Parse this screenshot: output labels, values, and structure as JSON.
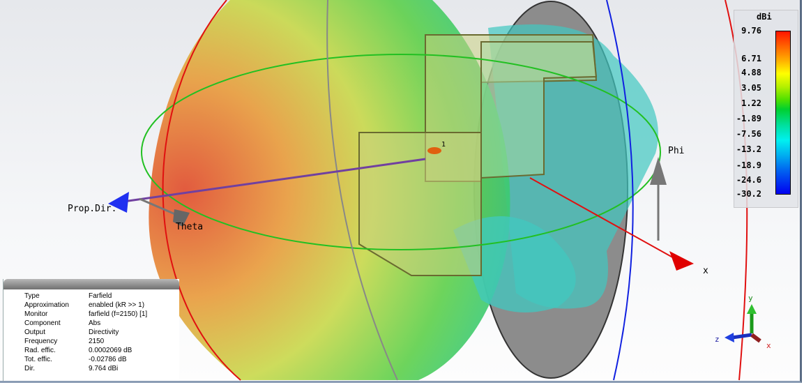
{
  "labels": {
    "prop_dir": "Prop.Dir.",
    "theta": "Theta",
    "phi": "Phi",
    "x": "x",
    "port": "1"
  },
  "legend": {
    "unit": "dBi",
    "ticks": [
      "9.76",
      "6.71",
      "4.88",
      "3.05",
      "1.22",
      "-1.89",
      "-7.56",
      "-13.2",
      "-18.9",
      "-24.6",
      "-30.2"
    ]
  },
  "axes": {
    "x": "x",
    "y": "y",
    "z": "z"
  },
  "info": [
    {
      "k": "Type",
      "v": "Farfield"
    },
    {
      "k": "Approximation",
      "v": "enabled (kR >> 1)"
    },
    {
      "k": "Monitor",
      "v": "farfield (f=2150) [1]"
    },
    {
      "k": "Component",
      "v": "Abs"
    },
    {
      "k": "Output",
      "v": "Directivity"
    },
    {
      "k": "Frequency",
      "v": "2150"
    },
    {
      "k": "Rad. effic.",
      "v": "0.0002069 dB"
    },
    {
      "k": "Tot. effic.",
      "v": "-0.02786 dB"
    },
    {
      "k": "Dir.",
      "v": "9.764 dBi"
    }
  ]
}
